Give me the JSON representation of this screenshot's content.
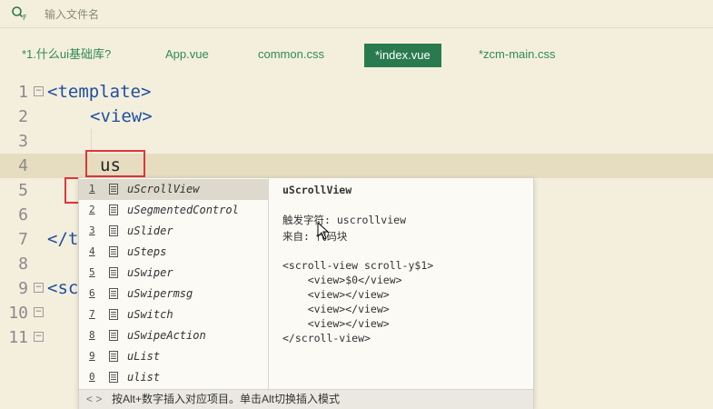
{
  "search": {
    "icon": "search-filter-icon",
    "placeholder": "输入文件名"
  },
  "tabs": [
    {
      "label": "*1.什么ui基础库?",
      "active": false
    },
    {
      "label": "App.vue",
      "active": false
    },
    {
      "label": "common.css",
      "active": false
    },
    {
      "label": "*index.vue",
      "active": true
    },
    {
      "label": "*zcm-main.css",
      "active": false
    }
  ],
  "editor": {
    "lines": [
      {
        "num": "1",
        "text": "<template>"
      },
      {
        "num": "2",
        "text": "<view>"
      },
      {
        "num": "3",
        "text": ""
      },
      {
        "num": "4",
        "text": "us"
      },
      {
        "num": "5",
        "text": ""
      },
      {
        "num": "6",
        "text": ""
      },
      {
        "num": "7",
        "text": "</t"
      },
      {
        "num": "8",
        "text": ""
      },
      {
        "num": "9",
        "text": "<sc"
      },
      {
        "num": "10",
        "text": ""
      },
      {
        "num": "11",
        "text": ""
      }
    ]
  },
  "completion": {
    "items": [
      {
        "num": "1",
        "label": "uScrollView"
      },
      {
        "num": "2",
        "label": "uSegmentedControl"
      },
      {
        "num": "3",
        "label": "uSlider"
      },
      {
        "num": "4",
        "label": "uSteps"
      },
      {
        "num": "5",
        "label": "uSwiper"
      },
      {
        "num": "6",
        "label": "uSwipermsg"
      },
      {
        "num": "7",
        "label": "uSwitch"
      },
      {
        "num": "8",
        "label": "uSwipeAction"
      },
      {
        "num": "9",
        "label": "uList"
      },
      {
        "num": "0",
        "label": "ulist"
      }
    ],
    "selected_index": 0,
    "detail": {
      "title": "uScrollView",
      "trigger": "触发字符: uscrollview",
      "source": "来自: 代码块",
      "code": [
        "<scroll-view scroll-y$1>",
        "    <view>$0</view>",
        "    <view></view>",
        "    <view></view>",
        "    <view></view>",
        "</scroll-view>"
      ]
    },
    "status": "按Alt+数字插入对应项目。单击Alt切换插入模式",
    "status_arrows": "< >"
  }
}
